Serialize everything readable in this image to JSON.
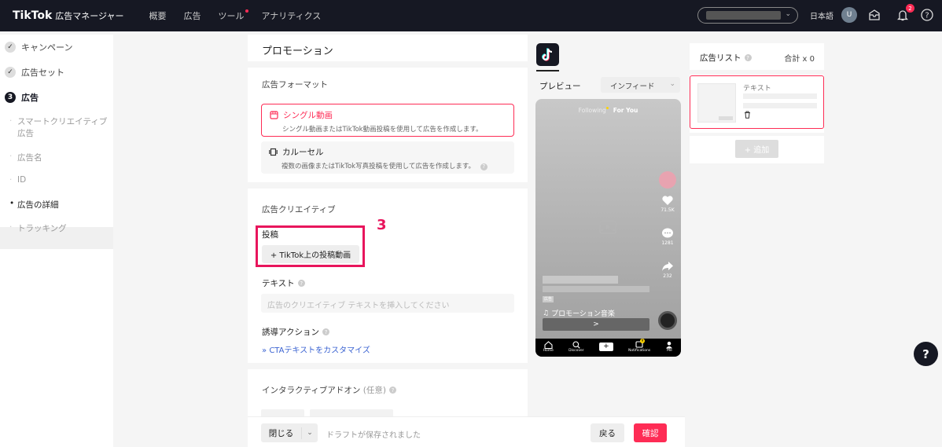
{
  "topbar": {
    "brand": "TikTok",
    "subtitle": "広告マネージャー",
    "nav": [
      "概要",
      "広告",
      "ツール",
      "アナリティクス"
    ],
    "language": "日本語",
    "avatar_initial": "U",
    "notification_count": "2"
  },
  "sidebar": {
    "steps": [
      {
        "label": "キャンペーン",
        "state": "done"
      },
      {
        "label": "広告セット",
        "state": "done"
      },
      {
        "label": "広告",
        "number": "3",
        "state": "active"
      }
    ],
    "sub_items": [
      "スマートクリエイティブ",
      "広告",
      "広告名",
      "ID",
      "広告の詳細",
      "トラッキング"
    ]
  },
  "form": {
    "title": "プロモーション",
    "format_section": "広告フォーマット",
    "formats": [
      {
        "title": "シングル動画",
        "desc": "シングル動画またはTikTok動画投稿を使用して広告を作成します。",
        "selected": true
      },
      {
        "title": "カルーセル",
        "desc": "複数の画像またはTikTok写真投稿を使用して広告を作成します。",
        "selected": false
      }
    ],
    "creative_section": "広告クリエイティブ",
    "post_label": "投稿",
    "post_button": "+ TikTok上の投稿動画",
    "annotation": "3",
    "text_label": "テキスト",
    "text_placeholder": "広告のクリエイティブ テキストを挿入してください",
    "cta_label": "誘導アクション",
    "cta_link": "CTAテキストをカスタマイズ",
    "interactive_label": "インタラクティブアドオン",
    "interactive_optional": "(任意)"
  },
  "bottombar": {
    "close": "閉じる",
    "draft": "ドラフトが保存されました",
    "back": "戻る",
    "confirm": "確認"
  },
  "preview": {
    "label": "プレビュー",
    "placement": "インフィード",
    "tab_following": "Following",
    "tab_foryou": "For You",
    "like_count": "71.5K",
    "comment_count": "1281",
    "share_count": "232",
    "ad_tag": "広告",
    "music": "プロモーション音楽",
    "cta_arrow": ">",
    "nav": [
      "Home",
      "Discover",
      "Notifications",
      "Me"
    ],
    "nav_badge": "9"
  },
  "adlist": {
    "title": "広告リスト",
    "total": "合計 x 0",
    "card_text": "テキスト",
    "add": "+ 追加"
  },
  "colors": {
    "accent": "#fe2c55",
    "annotation": "#e8155c",
    "dark": "#161823",
    "link": "#3c64d2"
  }
}
